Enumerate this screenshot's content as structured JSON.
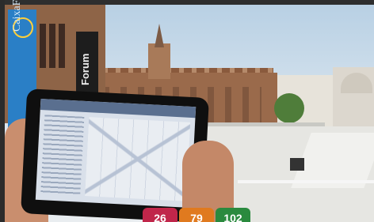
{
  "banner": {
    "blue_text": "CaixaForum",
    "dark_text": "Forum"
  },
  "badges": [
    {
      "value": "26",
      "color": "#c0264a"
    },
    {
      "value": "79",
      "color": "#e07a1f"
    },
    {
      "value": "102",
      "color": "#2a8a3e"
    }
  ],
  "colors": {
    "sky": "#cbdcea",
    "brick": "#9a6a4b",
    "banner_blue": "#2a7fc6"
  }
}
